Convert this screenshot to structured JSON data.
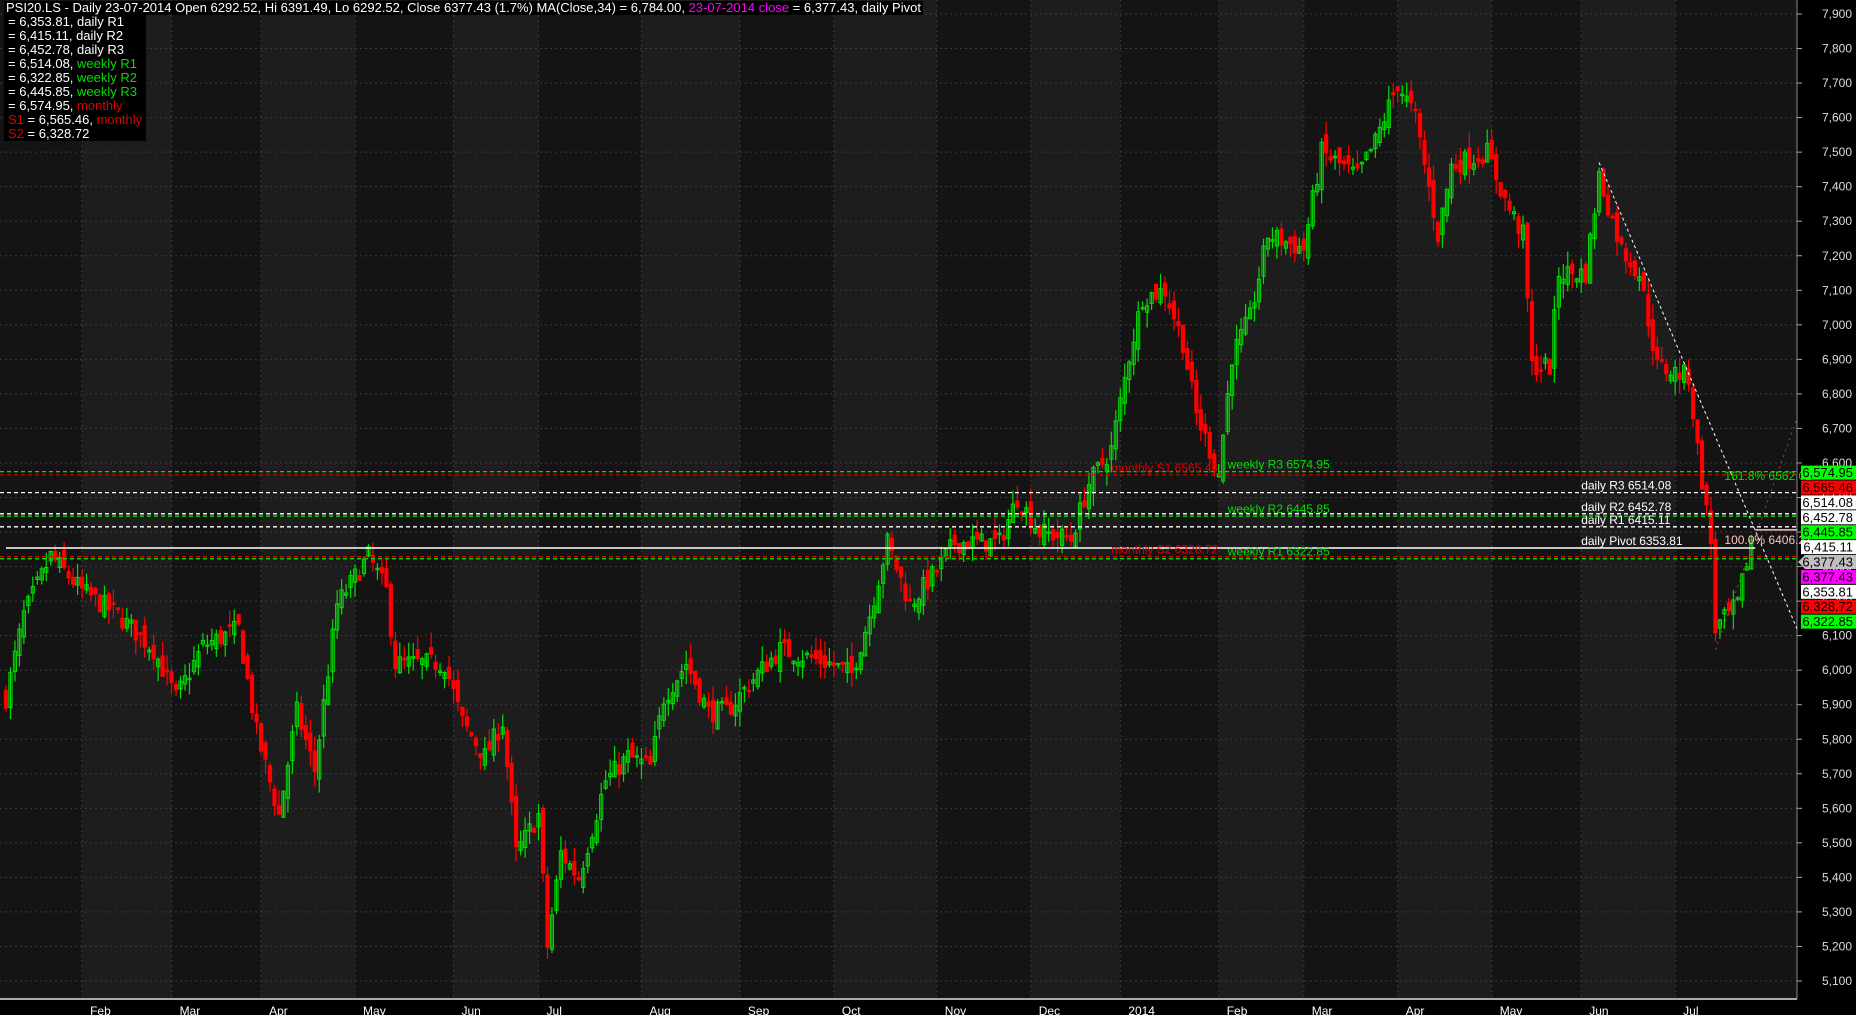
{
  "header": {
    "symbol": "PSI20.LS",
    "prefix": "PSI20.LS - Daily 23-07-2014 Open 6292.52, Hi 6391.49, Lo 6292.52, Close 6377.43 (1.7%) MA(Close,34) = 6,784.00, ",
    "close_date": "23-07-2014 close",
    "suffix": " = 6,377.43, daily Pivot"
  },
  "legend": [
    {
      "prefix": "",
      "value": "= 6,353.81, ",
      "name": "daily R1",
      "color": "#ffffff"
    },
    {
      "prefix": "",
      "value": "= 6,415.11, ",
      "name": "daily R2",
      "color": "#ffffff"
    },
    {
      "prefix": "",
      "value": "= 6,452.78, ",
      "name": "daily R3",
      "color": "#ffffff"
    },
    {
      "prefix": "",
      "value": "= 6,514.08, ",
      "name": "weekly R1",
      "color": "#00e000"
    },
    {
      "prefix": "",
      "value": "= 6,322.85, ",
      "name": "weekly R2",
      "color": "#00e000"
    },
    {
      "prefix": "",
      "value": "= 6,445.85, ",
      "name": "weekly R3",
      "color": "#00e000"
    },
    {
      "prefix": "",
      "value": "= 6,574.95, ",
      "name": "monthly",
      "color": "#e00000"
    },
    {
      "prefix": "S1",
      "value": " = 6,565.46, ",
      "name": "monthly",
      "color": "#e00000"
    },
    {
      "prefix": "S2",
      "value": " = 6,328.72",
      "name": "",
      "color": "#e00000"
    }
  ],
  "chart_data": {
    "type": "candlestick",
    "title": "PSI20.LS - Daily",
    "ylim": [
      5100,
      7900
    ],
    "yticks": [
      5100,
      5200,
      5300,
      5400,
      5500,
      5600,
      5700,
      5800,
      5900,
      6000,
      6100,
      6200,
      6300,
      6400,
      6500,
      6600,
      6700,
      6800,
      6900,
      7000,
      7100,
      7200,
      7300,
      7400,
      7500,
      7600,
      7700,
      7800,
      7900
    ],
    "ytick_labels": [
      "5,100",
      "5,200",
      "5,300",
      "5,400",
      "5,500",
      "5,600",
      "5,700",
      "5,800",
      "5,900",
      "6,000",
      "6,100",
      "6,200",
      "6,300",
      "6,400",
      "6,500",
      "6,600",
      "6,700",
      "6,800",
      "6,900",
      "7,000",
      "7,100",
      "7,200",
      "7,300",
      "7,400",
      "7,500",
      "7,600",
      "7,700",
      "7,800",
      "7,900"
    ],
    "x_range_days": [
      0,
      406
    ],
    "months": [
      {
        "label": "Feb",
        "day": 17
      },
      {
        "label": "Mar",
        "day": 37
      },
      {
        "label": "Apr",
        "day": 57
      },
      {
        "label": "May",
        "day": 78
      },
      {
        "label": "Jun",
        "day": 100
      },
      {
        "label": "Jul",
        "day": 119
      },
      {
        "label": "Aug",
        "day": 142
      },
      {
        "label": "Sep",
        "day": 164
      },
      {
        "label": "Oct",
        "day": 185
      },
      {
        "label": "Nov",
        "day": 208
      },
      {
        "label": "Dec",
        "day": 229
      },
      {
        "label": "2014",
        "day": 249
      },
      {
        "label": "Feb",
        "day": 271
      },
      {
        "label": "Mar",
        "day": 290
      },
      {
        "label": "Apr",
        "day": 311
      },
      {
        "label": "May",
        "day": 332
      },
      {
        "label": "Jun",
        "day": 352
      },
      {
        "label": "Jul",
        "day": 373
      }
    ],
    "close_keypoints": [
      [
        0,
        5920
      ],
      [
        4,
        6160
      ],
      [
        10,
        6330
      ],
      [
        17,
        6230
      ],
      [
        25,
        6160
      ],
      [
        33,
        6060
      ],
      [
        38,
        5920
      ],
      [
        44,
        6070
      ],
      [
        52,
        6120
      ],
      [
        56,
        5820
      ],
      [
        61,
        5580
      ],
      [
        65,
        5880
      ],
      [
        69,
        5710
      ],
      [
        74,
        6190
      ],
      [
        81,
        6330
      ],
      [
        85,
        6230
      ],
      [
        87,
        6020
      ],
      [
        98,
        6020
      ],
      [
        102,
        5850
      ],
      [
        107,
        5750
      ],
      [
        111,
        5850
      ],
      [
        114,
        5470
      ],
      [
        119,
        5580
      ],
      [
        121,
        5200
      ],
      [
        124,
        5470
      ],
      [
        128,
        5400
      ],
      [
        134,
        5680
      ],
      [
        139,
        5750
      ],
      [
        144,
        5720
      ],
      [
        147,
        5920
      ],
      [
        152,
        6020
      ],
      [
        157,
        5880
      ],
      [
        161,
        5880
      ],
      [
        168,
        5990
      ],
      [
        173,
        6060
      ],
      [
        184,
        6020
      ],
      [
        189,
        5990
      ],
      [
        193,
        6160
      ],
      [
        197,
        6370
      ],
      [
        202,
        6190
      ],
      [
        208,
        6290
      ],
      [
        212,
        6370
      ],
      [
        222,
        6370
      ],
      [
        226,
        6500
      ],
      [
        231,
        6400
      ],
      [
        238,
        6380
      ],
      [
        242,
        6540
      ],
      [
        247,
        6640
      ],
      [
        251,
        6910
      ],
      [
        254,
        7080
      ],
      [
        259,
        7100
      ],
      [
        263,
        6950
      ],
      [
        266,
        6740
      ],
      [
        271,
        6570
      ],
      [
        274,
        6910
      ],
      [
        278,
        7020
      ],
      [
        282,
        7260
      ],
      [
        290,
        7220
      ],
      [
        294,
        7500
      ],
      [
        302,
        7430
      ],
      [
        306,
        7530
      ],
      [
        311,
        7700
      ],
      [
        315,
        7600
      ],
      [
        320,
        7260
      ],
      [
        323,
        7460
      ],
      [
        331,
        7500
      ],
      [
        335,
        7360
      ],
      [
        339,
        7260
      ],
      [
        341,
        6880
      ],
      [
        345,
        6880
      ],
      [
        347,
        7150
      ],
      [
        353,
        7150
      ],
      [
        356,
        7430
      ],
      [
        361,
        7220
      ],
      [
        365,
        7150
      ],
      [
        369,
        6880
      ],
      [
        376,
        6850
      ],
      [
        378,
        6640
      ],
      [
        381,
        6370
      ],
      [
        382,
        6120
      ],
      [
        385,
        6160
      ],
      [
        387,
        6190
      ],
      [
        390,
        6377.43
      ]
    ],
    "last_candle": {
      "date": "23-07-2014",
      "open": 6292.52,
      "high": 6391.49,
      "low": 6292.52,
      "close": 6377.43
    },
    "levels": [
      {
        "label": "weekly R3 6574.95",
        "value": 6574.95,
        "color": "#00e000",
        "style": "dash",
        "label_day": 273
      },
      {
        "label": "monthly S1 6565.46",
        "value": 6565.46,
        "color": "#e00000",
        "style": "dash",
        "label_day": 247
      },
      {
        "label": "daily R3 6514.08",
        "value": 6514.08,
        "color": "#ffffff",
        "style": "dash",
        "label_day": 352
      },
      {
        "label": "daily R2 6452.78",
        "value": 6452.78,
        "color": "#ffffff",
        "style": "dash",
        "label_day": 352
      },
      {
        "label": "weekly R2 6445.85",
        "value": 6445.85,
        "color": "#00e000",
        "style": "dash",
        "label_day": 273
      },
      {
        "label": "daily R1  6415.11",
        "value": 6415.11,
        "color": "#ffffff",
        "style": "dash",
        "label_day": 352
      },
      {
        "label": "daily Pivot  6353.81",
        "value": 6353.81,
        "color": "#ffffff",
        "style": "solid",
        "label_day": 352
      },
      {
        "label": "monthly S2 6328.72",
        "value": 6328.72,
        "color": "#e00000",
        "style": "dash",
        "label_day": 247
      },
      {
        "label": "weekly R1  6322.85",
        "value": 6322.85,
        "color": "#00e000",
        "style": "dash",
        "label_day": 273
      }
    ],
    "fib": [
      {
        "label": "161.8% 6562.01",
        "value": 6562.01,
        "color": "#00e000"
      },
      {
        "label": "100.0% 6406.21",
        "value": 6406.21,
        "color": "#ffc0c0"
      }
    ],
    "axis_badges": [
      {
        "text": "6,574.95",
        "bg": "#00ff00",
        "fg": "#000000"
      },
      {
        "text": "6,565.46",
        "bg": "#ff0000",
        "fg": "#000000"
      },
      {
        "text": "6,514.08",
        "bg": "#ffffff",
        "fg": "#000000"
      },
      {
        "text": "6,452.78",
        "bg": "#ffffff",
        "fg": "#000000"
      },
      {
        "text": "6,445.85",
        "bg": "#00ff00",
        "fg": "#000000"
      },
      {
        "text": "6,415.11",
        "bg": "#ffffff",
        "fg": "#000000"
      },
      {
        "text": "6,377.43",
        "bg": "#c0c0c0",
        "fg": "#000000"
      },
      {
        "text": "6,377.43",
        "bg": "#ff00ff",
        "fg": "#000000"
      },
      {
        "text": "6,353.81",
        "bg": "#ffffff",
        "fg": "#000000"
      },
      {
        "text": "6,328.72",
        "bg": "#ff0000",
        "fg": "#000000"
      },
      {
        "text": "6,322.85",
        "bg": "#00ff00",
        "fg": "#000000"
      }
    ],
    "colors": {
      "up": "#00e000",
      "down": "#ff0000"
    }
  }
}
